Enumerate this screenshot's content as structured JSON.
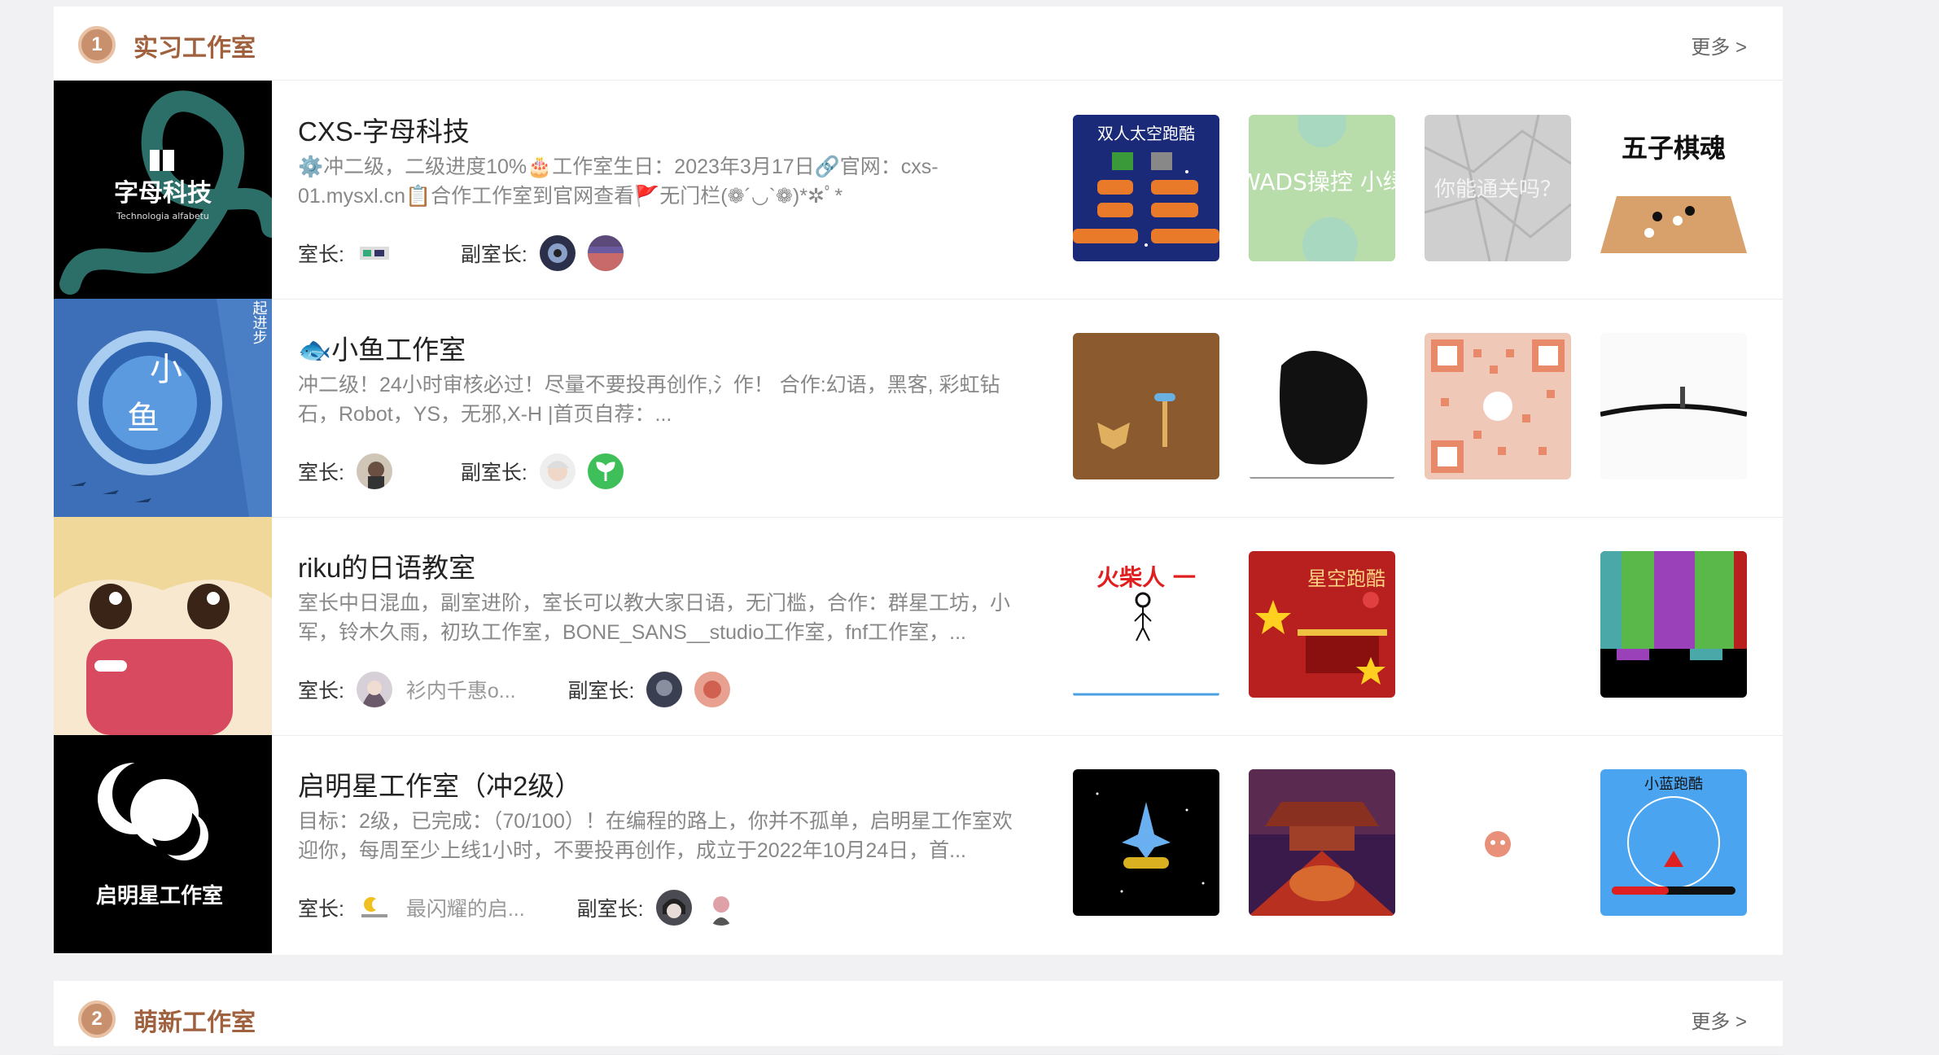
{
  "sections": [
    {
      "title": "实习工作室",
      "badge": "1",
      "more": "更多 >",
      "studios": [
        {
          "name": "CXS-字母科技",
          "desc": "⚙️冲二级，二级进度10%🎂工作室生日：2023年3月17日🔗官网：cxs-01.mysxl.cn📋合作工作室到官网查看🚩无门栏(❁´◡`❁)*✲ﾟ*",
          "leader_label": "室长:",
          "vice_label": "副室长:",
          "leader_name": "",
          "cover_text": "字母科技",
          "cover_sub": "Technologia alfabetu",
          "works": [
            "双人太空跑酷",
            "WADS操控 小绿",
            "你能通关吗？",
            "五子棋魂"
          ]
        },
        {
          "name": "🐟小鱼工作室",
          "desc": "冲二级！24小时审核必过！尽量不要投再创作,氵作！ 合作:幻语，黑客, 彩虹钻石，Robot，YS，无邪,X-H |首页自荐：...",
          "leader_label": "室长:",
          "vice_label": "副室长:",
          "leader_name": "",
          "cover_text_1": "小",
          "cover_text_2": "鱼",
          "cover_side": "一起进步",
          "works": [
            "",
            "",
            "",
            ""
          ]
        },
        {
          "name": "riku的日语教室",
          "desc": "室长中日混血，副室进阶，室长可以教大家日语，无门槛，合作：群星工坊，小军，铃木久雨，初玖工作室，BONE_SANS__studio工作室，fnf工作室，...",
          "leader_label": "室长:",
          "vice_label": "副室长:",
          "leader_name": "衫内千惠o...",
          "works": [
            "火柴人 一",
            "星空跑酷",
            "",
            ""
          ]
        },
        {
          "name": "启明星工作室（冲2级）",
          "desc": "目标：2级，已完成：（70/100）！在编程的路上，你并不孤单，启明星工作室欢迎你，每周至少上线1小时，不要投再创作，成立于2022年10月24日，首...",
          "leader_label": "室长:",
          "vice_label": "副室长:",
          "leader_name": "最闪耀的启...",
          "cover_text": "启明星工作室",
          "works": [
            "",
            "",
            "",
            "小蓝跑酷"
          ]
        }
      ]
    },
    {
      "title": "萌新工作室",
      "badge": "2",
      "more": "更多 >"
    }
  ],
  "colors": {
    "accent": "#a0613e",
    "badge": "#c8906d"
  }
}
